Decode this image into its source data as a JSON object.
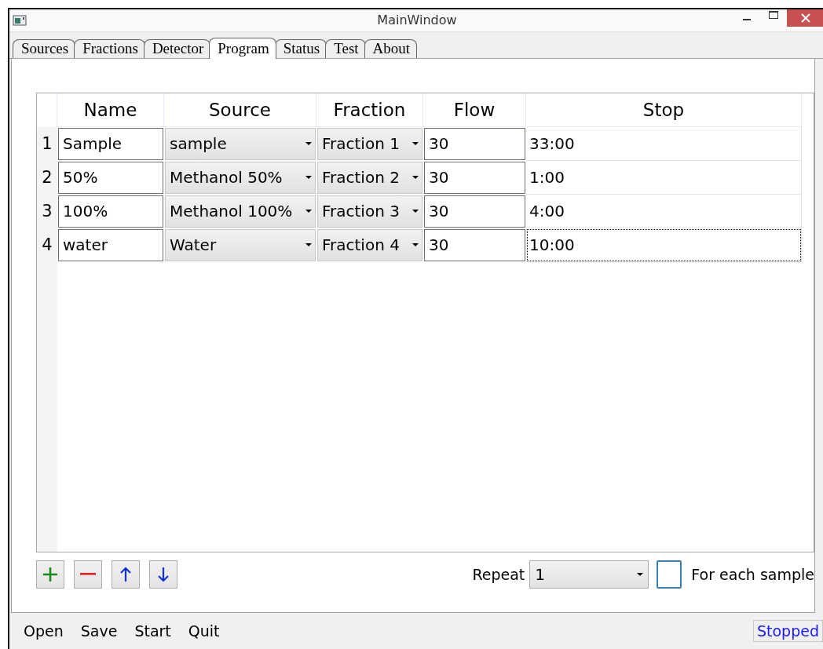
{
  "window": {
    "title": "MainWindow"
  },
  "tabs": [
    {
      "label": "Sources",
      "selected": false
    },
    {
      "label": "Fractions",
      "selected": false
    },
    {
      "label": "Detector",
      "selected": false
    },
    {
      "label": "Program",
      "selected": true
    },
    {
      "label": "Status",
      "selected": false
    },
    {
      "label": "Test",
      "selected": false
    },
    {
      "label": "About",
      "selected": false
    }
  ],
  "table": {
    "columns": [
      "Name",
      "Source",
      "Fraction",
      "Flow",
      "Stop"
    ],
    "rows": [
      {
        "number": "1",
        "name": "Sample",
        "source": "sample",
        "fraction": "Fraction 1",
        "flow": "30",
        "stop": "33:00",
        "focused": false
      },
      {
        "number": "2",
        "name": "50%",
        "source": "Methanol 50%",
        "fraction": "Fraction 2",
        "flow": "30",
        "stop": "1:00",
        "focused": false
      },
      {
        "number": "3",
        "name": "100%",
        "source": "Methanol 100%",
        "fraction": "Fraction 3",
        "flow": "30",
        "stop": "4:00",
        "focused": false
      },
      {
        "number": "4",
        "name": "water",
        "source": "Water",
        "fraction": "Fraction 4",
        "flow": "30",
        "stop": "10:00",
        "focused": true
      }
    ]
  },
  "row_buttons": [
    {
      "kind": "add"
    },
    {
      "kind": "remove"
    },
    {
      "kind": "up"
    },
    {
      "kind": "down"
    }
  ],
  "repeat": {
    "label": "Repeat",
    "value": "1"
  },
  "for_each_sample": {
    "label": "For each sample",
    "checked": false
  },
  "menu": [
    "Open",
    "Save",
    "Start",
    "Quit"
  ],
  "status": "Stopped"
}
